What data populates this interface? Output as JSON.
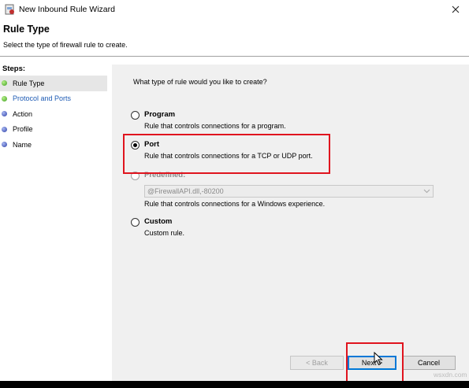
{
  "window": {
    "title": "New Inbound Rule Wizard",
    "close_glyph": "✕"
  },
  "header": {
    "title": "Rule Type",
    "subtitle": "Select the type of firewall rule to create."
  },
  "steps": {
    "title": "Steps:",
    "items": [
      {
        "label": "Rule Type",
        "status": "green"
      },
      {
        "label": "Protocol and Ports",
        "status": "green"
      },
      {
        "label": "Action",
        "status": "blue"
      },
      {
        "label": "Profile",
        "status": "blue"
      },
      {
        "label": "Name",
        "status": "blue"
      }
    ]
  },
  "main": {
    "question": "What type of rule would you like to create?",
    "options": {
      "program": {
        "label": "Program",
        "description": "Rule that controls connections for a program.",
        "checked": false
      },
      "port": {
        "label": "Port",
        "description": "Rule that controls connections for a TCP or UDP port.",
        "checked": true
      },
      "predefined": {
        "label": "Predefined:",
        "description": "Rule that controls connections for a Windows experience.",
        "checked": false,
        "disabled": true
      },
      "custom": {
        "label": "Custom",
        "description": "Custom rule.",
        "checked": false
      }
    },
    "predefined_select": {
      "value": "@FirewallAPI.dll,-80200"
    }
  },
  "buttons": {
    "back": "< Back",
    "next": "Next >",
    "cancel": "Cancel"
  },
  "watermark": "wsxdn.com",
  "colors": {
    "highlight_box": "#e0141e",
    "link": "#1e5bb4",
    "step_done": "#3f9e1f",
    "step_pending": "#2c3fa6"
  }
}
